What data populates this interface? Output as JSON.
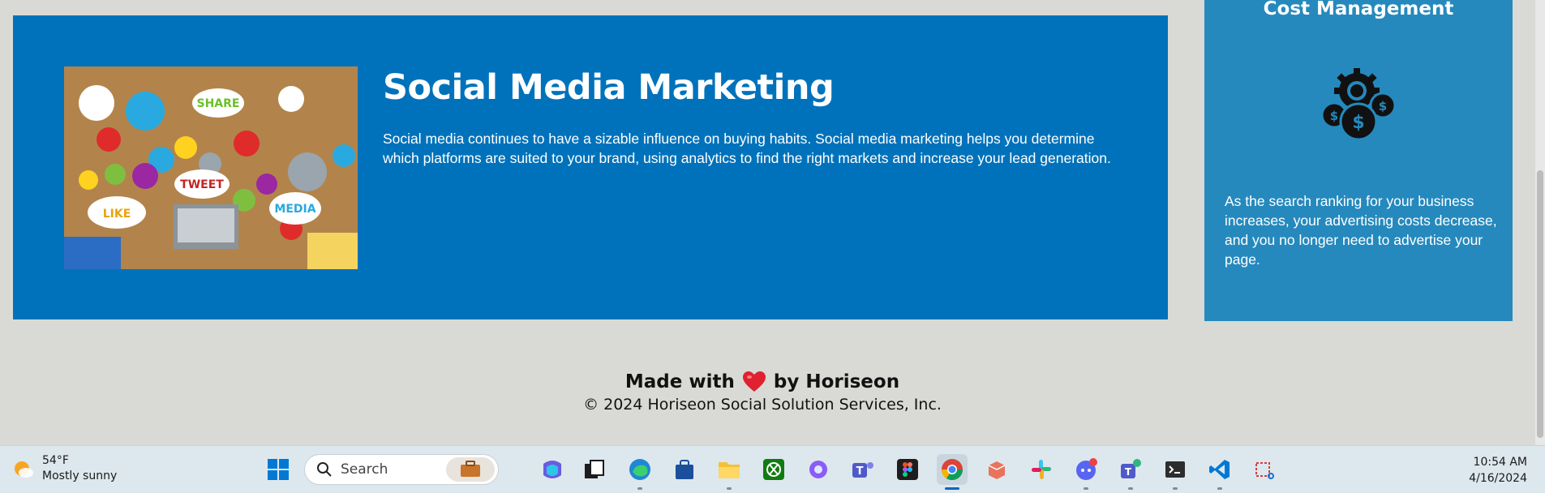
{
  "service": {
    "title": "Social Media Marketing",
    "text": "Social media continues to have a sizable influence on buying habits. Social media marketing helps you determine which platforms are suited to your brand, using analytics to find the right markets and increase your lead generation.",
    "image_words": [
      "SHARE",
      "TWEET",
      "LIKE",
      "MEDIA"
    ]
  },
  "benefit": {
    "title": "Cost Management",
    "icon": "gear-dollar-icon",
    "text": "As the search ranking for your business increases, your advertising costs decrease, and you no longer need to advertise your page."
  },
  "footer": {
    "made_prefix": "Made with",
    "made_suffix": "by Horiseon",
    "heart_color": "#e0212f",
    "copyright": "© 2024 Horiseon Social Solution Services, Inc."
  },
  "taskbar": {
    "weather_temp": "54°F",
    "weather_desc": "Mostly sunny",
    "search_label": "Search",
    "time": "10:54 AM",
    "date": "4/16/2024",
    "accent": "#0067c0"
  }
}
